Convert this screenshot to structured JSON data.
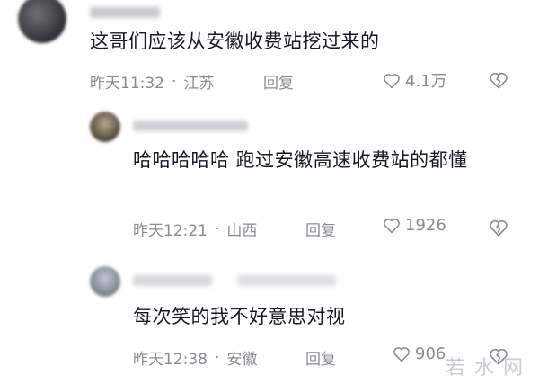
{
  "comments": [
    {
      "text": "这哥们应该从安徽收费站挖过来的",
      "time": "昨天11:32",
      "location": "江苏",
      "reply_label": "回复",
      "likes": "4.1万"
    },
    {
      "text": "哈哈哈哈哈 跑过安徽高速收费站的都懂",
      "time": "昨天12:21",
      "location": "山西",
      "reply_label": "回复",
      "likes": "1926"
    },
    {
      "text": "每次笑的我不好意思对视",
      "time": "昨天12:38",
      "location": "安徽",
      "reply_label": "回复",
      "likes": "906"
    }
  ],
  "meta_separator": "·",
  "watermark": "若水网",
  "colors": {
    "text": "#161823",
    "meta": "#8a8b91",
    "background": "#ffffff"
  }
}
